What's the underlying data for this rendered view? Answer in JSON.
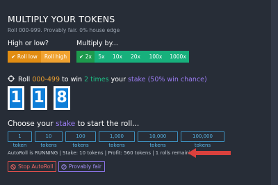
{
  "header": {
    "title": "MULTIPLY YOUR TOKENS",
    "subtitle": "Roll 000-999. Provably fair. 0% house edge"
  },
  "high_low": {
    "label": "High or low?",
    "options": [
      {
        "label": "Roll low",
        "selected": true,
        "icon": "check-icon"
      },
      {
        "label": "Roll high",
        "selected": false
      }
    ]
  },
  "multiply": {
    "label": "Multiply by...",
    "options": [
      {
        "label": "2x",
        "selected": true,
        "icon": "check-icon"
      },
      {
        "label": "5x",
        "selected": false
      },
      {
        "label": "10x",
        "selected": false
      },
      {
        "label": "20x",
        "selected": false
      },
      {
        "label": "100x",
        "selected": false
      },
      {
        "label": "1000x",
        "selected": false
      }
    ]
  },
  "roll": {
    "icon": "crosshair-icon",
    "prefix": "Roll",
    "range": "000-499",
    "to_win": "to win",
    "times": "2 times",
    "your": "your",
    "stake": "stake",
    "chance": "(50% win chance)"
  },
  "result_digits": [
    "1",
    "1",
    "8"
  ],
  "choose": {
    "prefix": "Choose your",
    "stake": "stake",
    "suffix": "to start the roll...",
    "chips": [
      "1 token",
      "10 tokens",
      "100 tokens",
      "1,000 tokens",
      "10,000 tokens",
      "100,000 tokens"
    ]
  },
  "status": {
    "text": "AutoRoll is RUNNING | Stake: 10 tokens | Profit: 560 tokens | 1 rolls remaining"
  },
  "buttons": {
    "stop": {
      "label": "Stop AutoRoll",
      "icon": "ban-icon"
    },
    "fair": {
      "label": "Provably fair",
      "icon": "question-circle-icon"
    }
  },
  "colors": {
    "background": "#272d37",
    "orange": "#f0a230",
    "green": "#17b07c",
    "blue": "#0e7ed8",
    "purple": "#9b7cf2",
    "red": "#e0504c"
  }
}
